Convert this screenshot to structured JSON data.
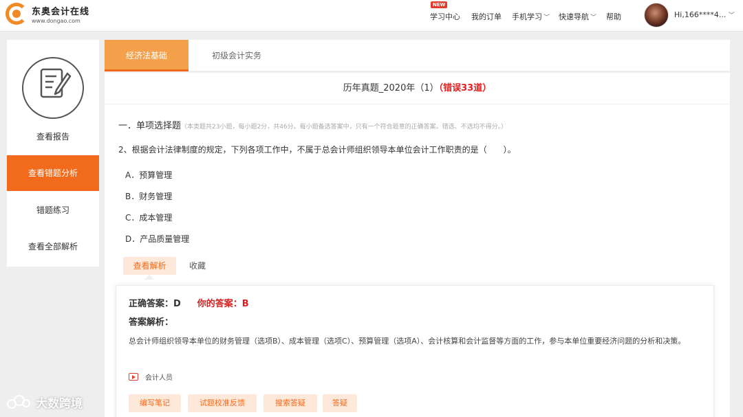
{
  "header": {
    "logo_cn": "东奥会计在线",
    "logo_url": "www.dongao.com",
    "new_badge": "NEW",
    "nav": [
      {
        "label": "学习中心",
        "chevron": ""
      },
      {
        "label": "我的订单",
        "chevron": ""
      },
      {
        "label": "手机学习",
        "chevron": "﹀"
      },
      {
        "label": "快速导航",
        "chevron": "﹀"
      },
      {
        "label": "帮助",
        "chevron": ""
      }
    ],
    "user_greeting": "Hi,166****4...",
    "user_chevron": "﹀"
  },
  "sidebar": {
    "items": [
      {
        "label": "查看报告"
      },
      {
        "label": "查看错题分析"
      },
      {
        "label": "错题练习"
      },
      {
        "label": "查看全部解析"
      }
    ]
  },
  "tabs": [
    {
      "label": "经济法基础"
    },
    {
      "label": "初级会计实务"
    }
  ],
  "main": {
    "title": "历年真题_2020年（1）",
    "wrong_count": "（错误33道）",
    "section_title": "一．单项选择题",
    "section_note": "（本类题共23小题，每小题2分，共46分。每小题备选答案中，只有一个符合题意的正确答案。错选、不选均不得分。）",
    "question": "2、根据会计法律制度的规定，下列各项工作中，不属于总会计师组织领导本单位会计工作职责的是（　　）。",
    "options": [
      "A．预算管理",
      "B．财务管理",
      "C．成本管理",
      "D．产品质量管理"
    ],
    "view_analysis": "查看解析",
    "favorite": "收藏"
  },
  "analysis": {
    "correct_answer": "正确答案：D",
    "your_answer": "你的答案：B",
    "explanation_title": "答案解析：",
    "explanation": "总会计师组织领导本单位的财务管理（选项B）、成本管理（选项C）、预算管理（选项A）、会计核算和会计监督等方面的工作，参与本单位重要经济问题的分析和决策。",
    "tag": "会计人员",
    "actions": [
      "编写笔记",
      "试题校准反馈",
      "搜索答疑",
      "答疑"
    ]
  },
  "watermark": "大数跨境"
}
